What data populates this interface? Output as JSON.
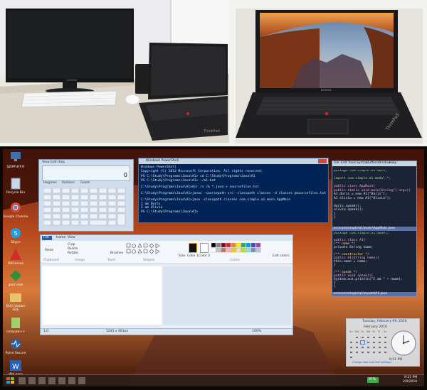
{
  "desk_photo": {
    "monitor_brand": "Lenovo",
    "laptop_brand": "ThinkPad"
  },
  "laptop_photo": {
    "brand_front": "Lenovo",
    "brand_side": "ThinkPad"
  },
  "screen_photo": {
    "desktop_icons": [
      {
        "label": "SZIPFUFFIY",
        "icon": "computer-icon"
      },
      {
        "label": "Recycle Bin",
        "icon": "recycle-bin-icon"
      },
      {
        "label": "Google Chrome",
        "icon": "chrome-icon"
      },
      {
        "label": "Skype",
        "icon": "skype-icon"
      },
      {
        "label": "DSGames",
        "icon": "pdf-icon"
      },
      {
        "label": "gvim.exe",
        "icon": "vim-icon"
      },
      {
        "label": "BUJI (Adobe SDE",
        "icon": "folder-icon"
      },
      {
        "label": "notepad++",
        "icon": "notepad-icon"
      },
      {
        "label": "Pulse Secure",
        "icon": "pulse-icon"
      },
      {
        "label": "WeLearn",
        "icon": "w-icon"
      }
    ],
    "powershell": {
      "title": "Windows PowerShell",
      "lines": [
        "Windows PowerShell",
        "Copyright (C) 2013 Microsoft Corporation. All rights reserved.",
        "PS C:\\Study\\Programs\\Java\\A1> cd C:\\Study\\Programs\\Java\\A1",
        "PS C:\\Study\\Programs\\Java\\A1> ./a1.bat",
        "",
        "C:\\Study\\Programs\\Java\\A1>dir /s /b *.java > sourcefiles.txt",
        "",
        "C:\\Study\\Programs\\Java\\A1>javac -sourcepath src -classpath classes -d classes @sourcefiles.txt",
        "",
        "C:\\Study\\Programs\\Java\\A1>java -classpath classes com.simple.a1.main.AppMain",
        "I am Doris",
        "I am Olivia",
        "PS C:\\Study\\Programs\\Java\\A1>"
      ]
    },
    "calculator": {
      "menu": [
        "View",
        "Edit",
        "Help"
      ],
      "display": "0",
      "modes": [
        "Degrees",
        "Radians",
        "Grads"
      ]
    },
    "paint": {
      "tabs": [
        "File",
        "Home",
        "View"
      ],
      "groups": [
        "Clipboard",
        "Image",
        "Tools",
        "Shapes",
        "Colors"
      ],
      "tools": [
        "Paste",
        "Crop",
        "Resize",
        "Rotate",
        "Brushes",
        "Size",
        "Color 1",
        "Color 2",
        "Edit colors"
      ],
      "status_left": "1,0",
      "status_size": "1245 x 461px",
      "zoom": "100%"
    },
    "editor": {
      "menu": [
        "File",
        "Edit",
        "Tools",
        "Syntax",
        "Buffers",
        "Window",
        "Help"
      ],
      "top_code": [
        "package com.simple.a1.main;",
        "",
        "import com.simple.a1.model.*;",
        "",
        "public class AppMain{",
        "    public static void main(String[] args){",
        "        A1 doris = new A1(\"Doris\");",
        "        A1 olivia = new A1(\"Olivia\");",
        "",
        "        doris.speak();",
        "        olivia.speak();",
        "    }",
        "}"
      ],
      "top_status": "src\\com\\simple\\a1\\main\\AppMain.java",
      "bottom_code": [
        "package com.simple.a1.model;",
        "",
        "public class A1{",
        "    /** name */",
        "    private String name;",
        "",
        "    /** constructor */",
        "    public A1(String name){",
        "        this.name = name;",
        "    }",
        "",
        "    /** speak */",
        "    public void speak(){",
        "        System.out.println(\"I am \" + name);",
        "    }",
        "}"
      ],
      "bottom_status": "src\\com\\simple\\a1\\model\\A1.java"
    },
    "calendar_gadget": {
      "header": "Tuesday, February 09, 2016",
      "month": "February 2016",
      "weekdays": [
        "Su",
        "Mo",
        "Tu",
        "We",
        "Th",
        "Fr",
        "Sa"
      ],
      "footer": "Change date and time settings..."
    },
    "clock_gadget": {
      "time": "9:51 PM"
    },
    "taskbar": {
      "clock_time": "9:51 PM",
      "clock_date": "2/9/2016",
      "battery": "97%"
    }
  }
}
